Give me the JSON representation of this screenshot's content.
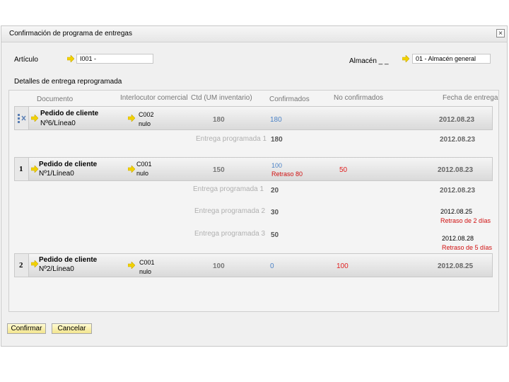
{
  "dialog": {
    "title": "Confirmación de programa de entregas",
    "close_glyph": "×"
  },
  "fields": {
    "article_label": "Artículo",
    "article_value": "I001 -",
    "warehouse_label": "Almacén _ _",
    "warehouse_value": "01 - Almacén general"
  },
  "section_label": "Detalles de entrega reprogramada",
  "columns": {
    "document": "Documento",
    "partner": "Interlocutor comercial",
    "qty": "Ctd (UM inventario)",
    "confirmed": "Confirmados",
    "unconfirmed": "No confirmados",
    "date": "Fecha de entrega"
  },
  "groups": [
    {
      "index": "",
      "doc_title": "Pedido de cliente",
      "doc_line": "Nº6/Línea0",
      "partner_code": "C002",
      "partner_name": "nulo",
      "qty": "180",
      "confirmed": "180",
      "confirmed_note": "",
      "unconfirmed": "",
      "date": "2012.08.23",
      "deliveries": [
        {
          "label": "Entrega programada 1",
          "qty": "180",
          "date": "2012.08.23",
          "delay": ""
        }
      ]
    },
    {
      "index": "1",
      "doc_title": "Pedido de cliente",
      "doc_line": "Nº1/Línea0",
      "partner_code": "C001",
      "partner_name": "nulo",
      "qty": "150",
      "confirmed": "100",
      "confirmed_note": "Retraso 80",
      "unconfirmed": "50",
      "date": "2012.08.23",
      "deliveries": [
        {
          "label": "Entrega programada 1",
          "qty": "20",
          "date": "2012.08.23",
          "delay": ""
        },
        {
          "label": "Entrega programada 2",
          "qty": "30",
          "date": "2012.08.25",
          "delay": "Retraso de 2 días"
        },
        {
          "label": "Entrega programada 3",
          "qty": "50",
          "date": "2012.08.28",
          "delay": "Retraso de 5 días"
        }
      ]
    },
    {
      "index": "2",
      "doc_title": "Pedido de cliente",
      "doc_line": "Nº2/Línea0",
      "partner_code": "C001",
      "partner_name": "nulo",
      "qty": "100",
      "confirmed": "0",
      "confirmed_note": "",
      "unconfirmed": "100",
      "date": "2012.08.25",
      "deliveries": []
    }
  ],
  "buttons": {
    "confirm": "Confirmar",
    "cancel": "Cancelar"
  },
  "colors": {
    "arrow": "#f2d200",
    "accent_blue": "#4c83c7",
    "alert_red": "#e02020"
  }
}
